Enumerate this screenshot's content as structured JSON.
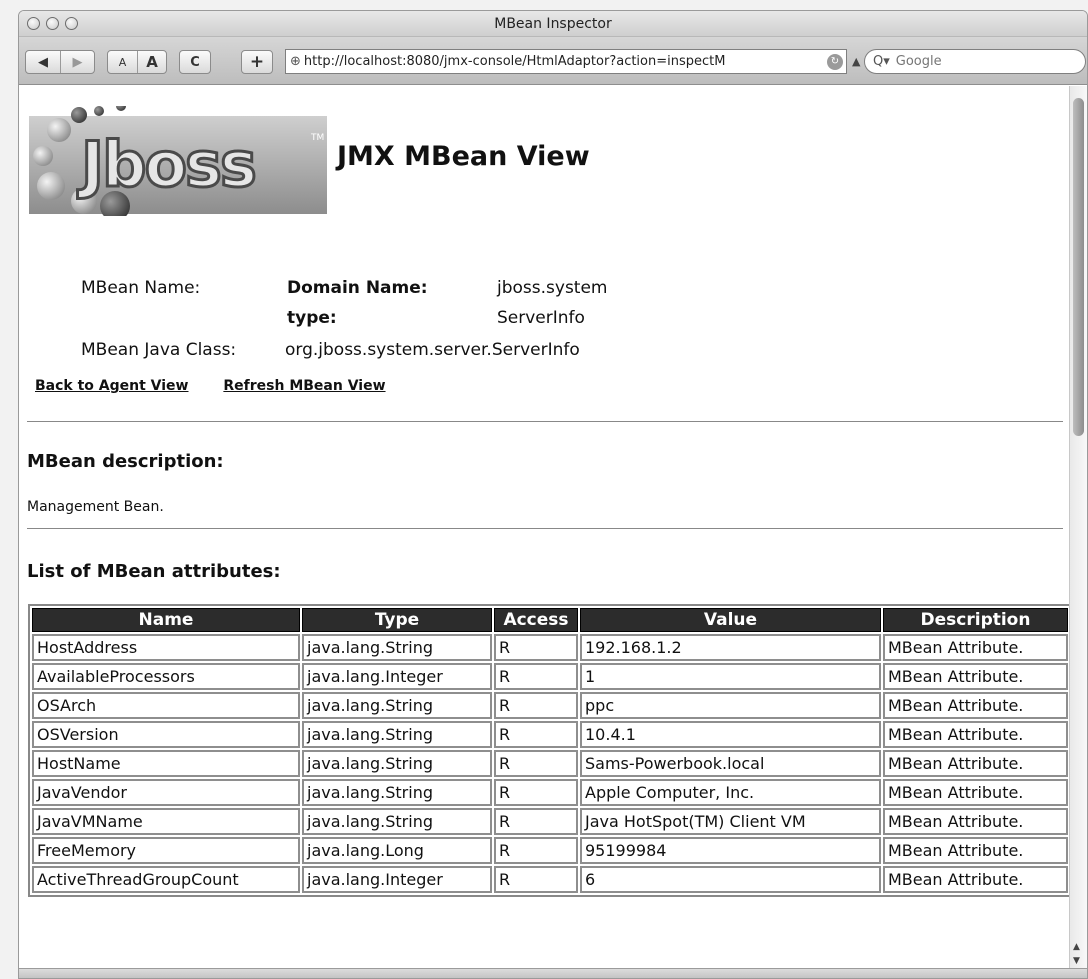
{
  "window": {
    "title": "MBean Inspector",
    "url": "http://localhost:8080/jmx-console/HtmlAdaptor?action=inspectM",
    "search_placeholder": "Google",
    "toolbar": {
      "back_icon": "back-arrow-icon",
      "forward_icon": "forward-arrow-icon",
      "text_smaller_label": "A",
      "text_bigger_label": "A",
      "reload_label": "C",
      "add_bookmark_label": "+"
    }
  },
  "page": {
    "logo_text": "Jboss",
    "heading": "JMX MBean View",
    "info": {
      "mbean_name_label": "MBean Name:",
      "domain_name_key": "Domain Name:",
      "domain_name_value": "jboss.system",
      "type_key": "type:",
      "type_value": "ServerInfo",
      "java_class_label": "MBean Java Class:",
      "java_class_value": "org.jboss.system.server.ServerInfo"
    },
    "links": {
      "back": "Back to Agent View",
      "refresh": "Refresh MBean View"
    },
    "description_heading": "MBean description:",
    "description_text": "Management Bean.",
    "attributes_heading": "List of MBean attributes:",
    "table": {
      "headers": [
        "Name",
        "Type",
        "Access",
        "Value",
        "Description"
      ],
      "rows": [
        [
          "HostAddress",
          "java.lang.String",
          "R",
          "192.168.1.2",
          "MBean Attribute."
        ],
        [
          "AvailableProcessors",
          "java.lang.Integer",
          "R",
          "1",
          "MBean Attribute."
        ],
        [
          "OSArch",
          "java.lang.String",
          "R",
          "ppc",
          "MBean Attribute."
        ],
        [
          "OSVersion",
          "java.lang.String",
          "R",
          "10.4.1",
          "MBean Attribute."
        ],
        [
          "HostName",
          "java.lang.String",
          "R",
          "Sams-Powerbook.local",
          "MBean Attribute."
        ],
        [
          "JavaVendor",
          "java.lang.String",
          "R",
          "Apple Computer, Inc.",
          "MBean Attribute."
        ],
        [
          "JavaVMName",
          "java.lang.String",
          "R",
          "Java HotSpot(TM) Client VM",
          "MBean Attribute."
        ],
        [
          "FreeMemory",
          "java.lang.Long",
          "R",
          "95199984",
          "MBean Attribute."
        ],
        [
          "ActiveThreadGroupCount",
          "java.lang.Integer",
          "R",
          "6",
          "MBean Attribute."
        ]
      ]
    }
  }
}
